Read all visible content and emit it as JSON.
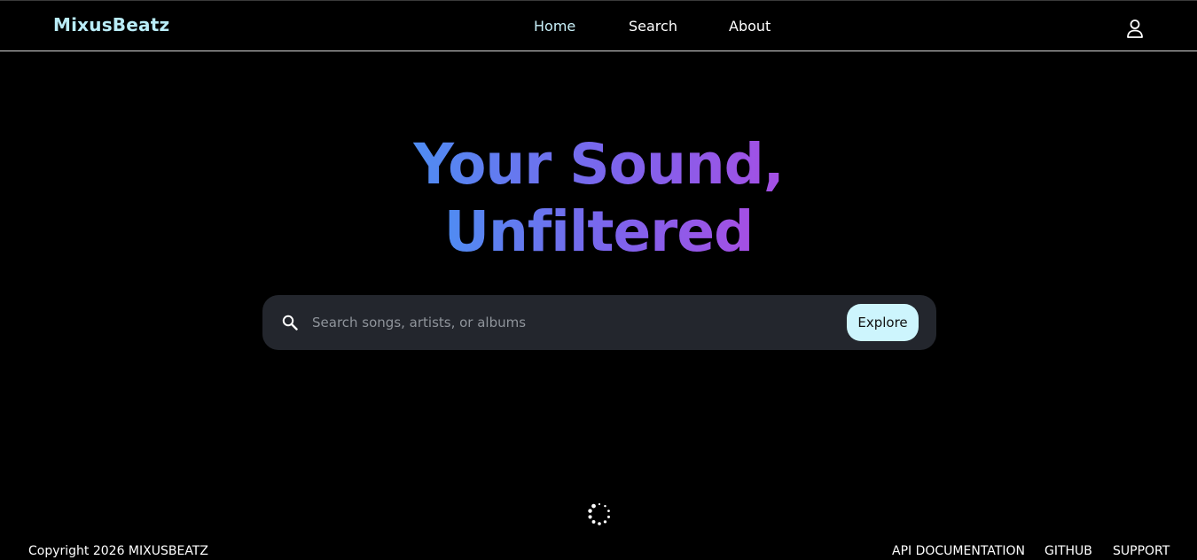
{
  "brand": {
    "name": "MixusBeatz"
  },
  "nav": {
    "items": [
      {
        "label": "Home",
        "active": true
      },
      {
        "label": "Search",
        "active": false
      },
      {
        "label": "About",
        "active": false
      }
    ],
    "user_icon": "user-icon"
  },
  "hero": {
    "line1": "Your Sound,",
    "line2": "Unfiltered",
    "gradient_colors": [
      "#4f8cf2",
      "#7d64ec",
      "#a54fe4"
    ]
  },
  "search": {
    "icon": "search-icon",
    "placeholder": "Search songs, artists, or albums",
    "value": "",
    "button_label": "Explore"
  },
  "status": {
    "spinner_icon": "loading-spinner-icon"
  },
  "footer": {
    "copyright": "Copyright 2026 MIXUSBEATZ",
    "links": [
      "API DOCUMENTATION",
      "GITHUB",
      "SUPPORT"
    ]
  },
  "colors": {
    "background": "#000000",
    "brand": "#b9ecf7",
    "search_bg": "#23262d",
    "button_bg": "#cdf5fd"
  }
}
